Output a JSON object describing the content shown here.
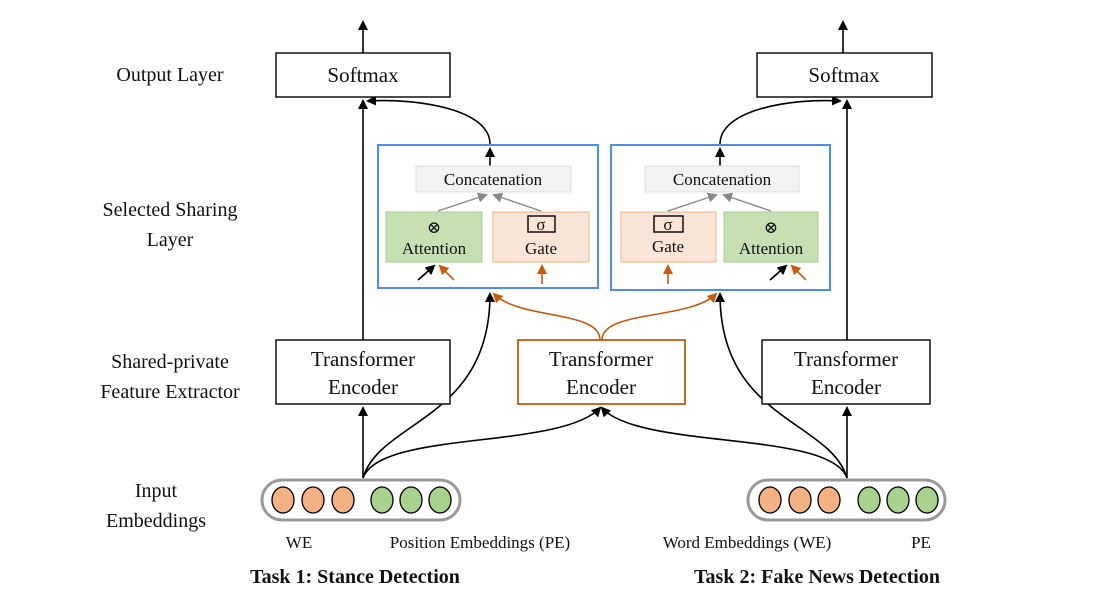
{
  "layer_labels": {
    "output": "Output Layer",
    "sharing_1": "Selected Sharing",
    "sharing_2": "Layer",
    "extractor_1": "Shared-private",
    "extractor_2": "Feature Extractor",
    "input_1": "Input",
    "input_2": "Embeddings"
  },
  "task1": {
    "softmax": "Softmax",
    "concat": "Concatenation",
    "attention_symbol": "⊗",
    "attention": "Attention",
    "gate_symbol": "σ",
    "gate": "Gate",
    "encoder_1": "Transformer",
    "encoder_2": "Encoder",
    "we_label": "WE",
    "pe_label": "Position Embeddings (PE)",
    "title": "Task 1: Stance Detection"
  },
  "shared": {
    "encoder_1": "Transformer",
    "encoder_2": "Encoder"
  },
  "task2": {
    "softmax": "Softmax",
    "concat": "Concatenation",
    "attention_symbol": "⊗",
    "attention": "Attention",
    "gate_symbol": "σ",
    "gate": "Gate",
    "encoder_1": "Transformer",
    "encoder_2": "Encoder",
    "we_label": "Word Embeddings (WE)",
    "pe_label": "PE",
    "title": "Task 2: Fake News Detection"
  },
  "colors": {
    "sharing_border": "#4a8ef0",
    "shared_encoder": "#c55a11",
    "attention_fill": "#c6e0b4",
    "attention_border": "#a9d18e",
    "gate_fill": "#fbe5d6",
    "gate_border": "#f4b183",
    "word_embedding": "#f4b183",
    "position_embedding": "#a9d18e",
    "concat_fill": "#f2f2f2"
  }
}
